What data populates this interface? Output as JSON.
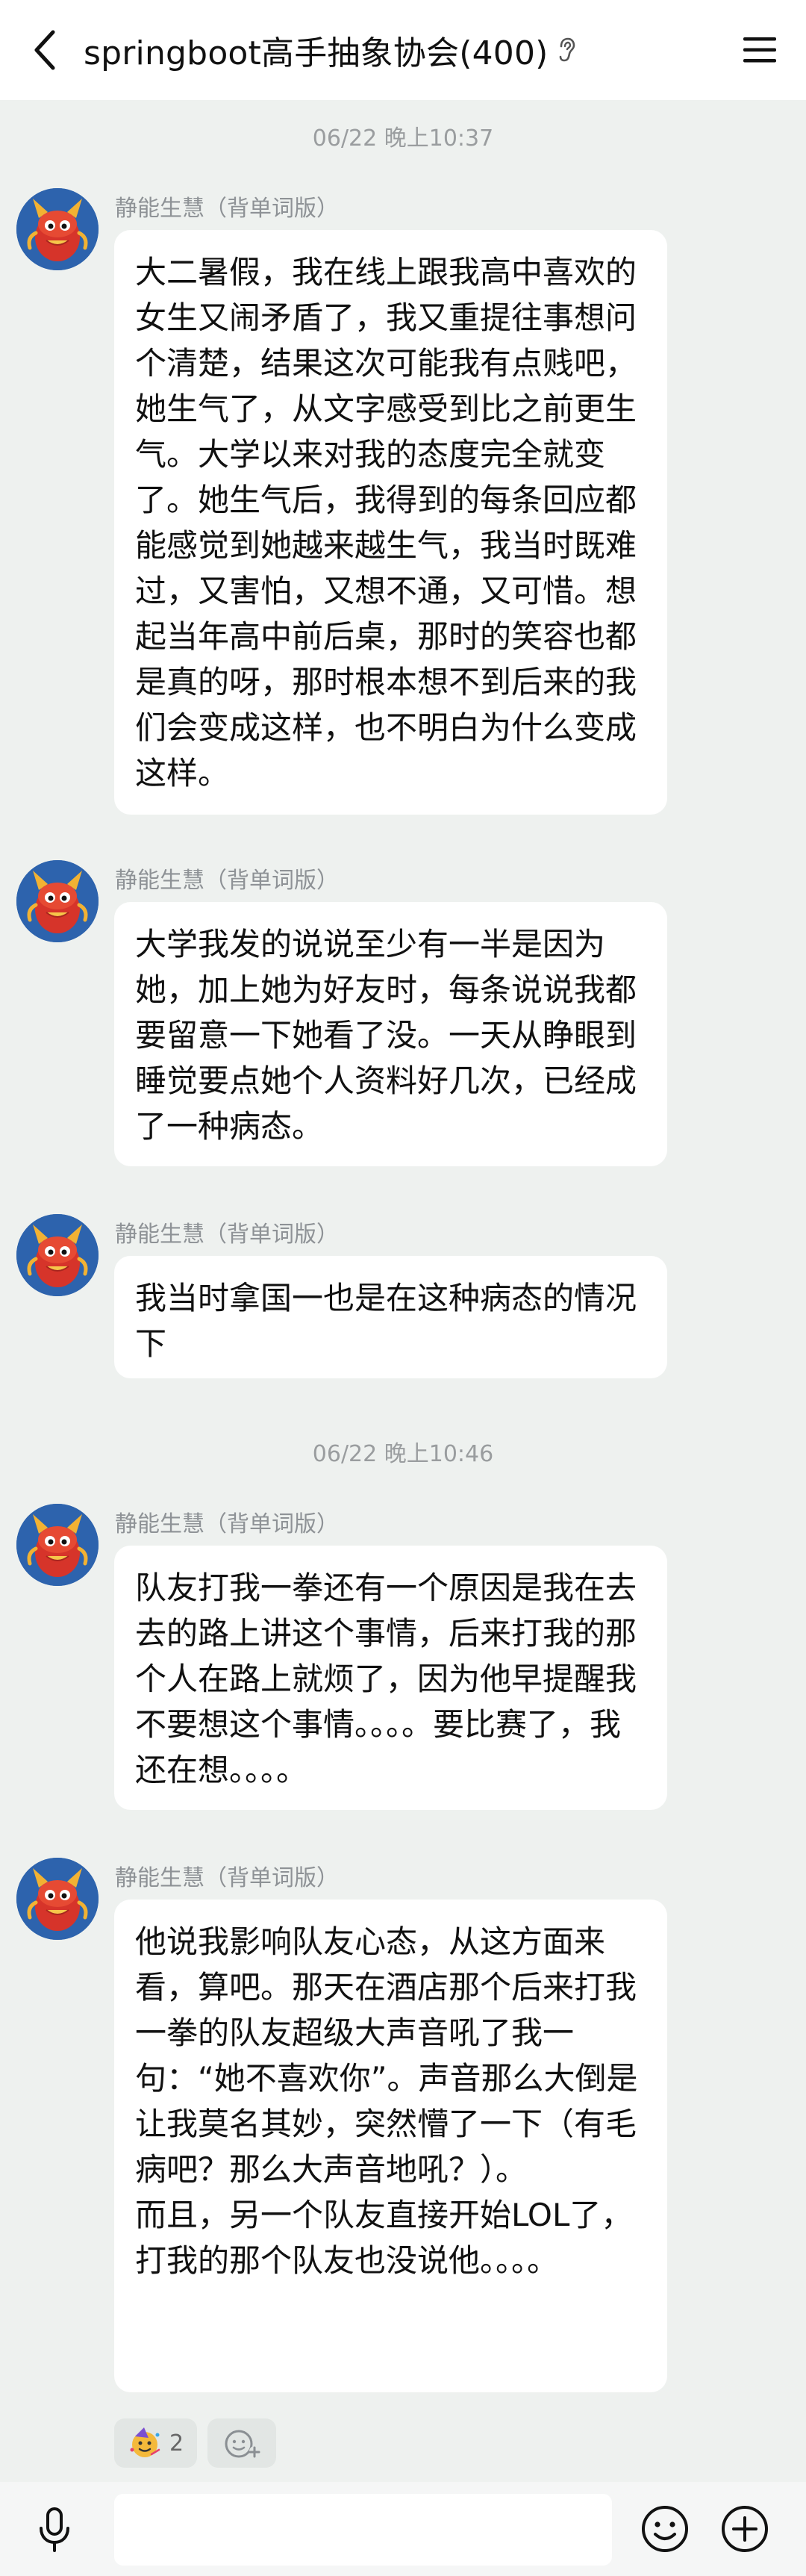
{
  "header": {
    "title": "springboot高手抽象协会(400)",
    "back_icon": "chevron-left-icon",
    "title_icon": "ear-icon",
    "menu_icon": "hamburger-menu-icon"
  },
  "timestamps": [
    "06/22 晚上10:37",
    "06/22 晚上10:46"
  ],
  "messages": [
    {
      "sender": "静能生慧（背单词版）",
      "text": "大二暑假，我在线上跟我高中喜欢的女生又闹矛盾了，我又重提往事想问个清楚，结果这次可能我有点贱吧，她生气了，从文字感受到比之前更生气。大学以来对我的态度完全就变了。她生气后，我得到的每条回应都能感觉到她越来越生气，我当时既难过，又害怕，又想不通，又可惜。想起当年高中前后桌，那时的笑容也都是真的呀，那时根本想不到后来的我们会变成这样，也不明白为什么变成这样。"
    },
    {
      "sender": "静能生慧（背单词版）",
      "text": "大学我发的说说至少有一半是因为她，加上她为好友时，每条说说我都要留意一下她看了没。一天从睁眼到睡觉要点她个人资料好几次，已经成了一种病态。"
    },
    {
      "sender": "静能生慧（背单词版）",
      "text": "我当时拿国一也是在这种病态的情况下"
    },
    {
      "sender": "静能生慧（背单词版）",
      "text": "队友打我一拳还有一个原因是我在去去的路上讲这个事情，后来打我的那个人在路上就烦了，因为他早提醒我不要想这个事情。。。。要比赛了，我还在想。。。。"
    },
    {
      "sender": "静能生慧（背单词版）",
      "text": "他说我影响队友心态，从这方面来看，算吧。那天在酒店那个后来打我一拳的队友超级大声音吼了我一句：“她不喜欢你”。声音那么大倒是让我莫名其妙，突然懵了一下（有毛病吧？那么大声音地吼？）。\n而且，另一个队友直接开始LOL了，打我的那个队友也没说他。。。。"
    }
  ],
  "reactions": {
    "emoji_icon": "party-face-emoji-icon",
    "count": "2",
    "add_icon": "add-reaction-icon"
  },
  "input_bar": {
    "mic_icon": "microphone-icon",
    "placeholder": "",
    "emoji_icon": "smiley-face-icon",
    "plus_icon": "plus-circle-icon"
  },
  "colors": {
    "background": "#eef1ef",
    "bubble": "#ffffff",
    "header": "#ffffff",
    "sender_text": "#8e9296",
    "timestamp_text": "#9a9d9f"
  }
}
